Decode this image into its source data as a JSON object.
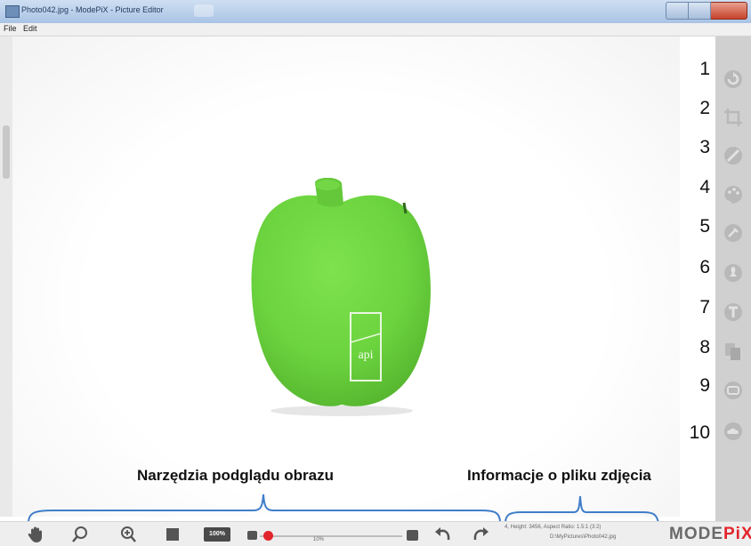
{
  "window": {
    "title": "Photo042.jpg - ModePiX - Picture Editor",
    "menu": [
      "File",
      "Edit"
    ]
  },
  "image": {
    "label_text": "api",
    "apple_color": "#6cd43f",
    "stem_color": "#64c83a"
  },
  "side_tools": {
    "numbers": [
      "1",
      "2",
      "3",
      "4",
      "5",
      "6",
      "7",
      "8",
      "9",
      "10"
    ],
    "icons": [
      "rotate-icon",
      "crop-icon",
      "ban-icon",
      "palette-icon",
      "effects-icon",
      "stamp-icon",
      "text-icon",
      "copy-icon",
      "frame-icon",
      "cloud-icon"
    ]
  },
  "annotations": {
    "preview_tools": "Narzędzia podglądu obrazu",
    "file_info": "Informacje o pliku zdjęcia"
  },
  "bottom_toolbar": {
    "icons": [
      "hand-icon",
      "zoom-out-icon",
      "zoom-in-icon",
      "fit-screen-icon",
      "zoom-100-icon",
      "zoom-min-icon",
      "zoom-max-icon",
      "undo-icon",
      "redo-icon"
    ],
    "zoom_100_label": "100%",
    "zoom_percent": "10%",
    "file_info_line1": "4, Height: 3456, Aspect Ratio: 1.5:1 (3:2)",
    "file_info_line2": "D:\\MyPictures\\Photo042.jpg"
  },
  "logo": {
    "part1": "MODE",
    "part2": "PiX"
  },
  "colors": {
    "accent_red": "#e2242b",
    "panel_gray": "#d0d0d0",
    "icon_gray": "#9a9a9a"
  }
}
